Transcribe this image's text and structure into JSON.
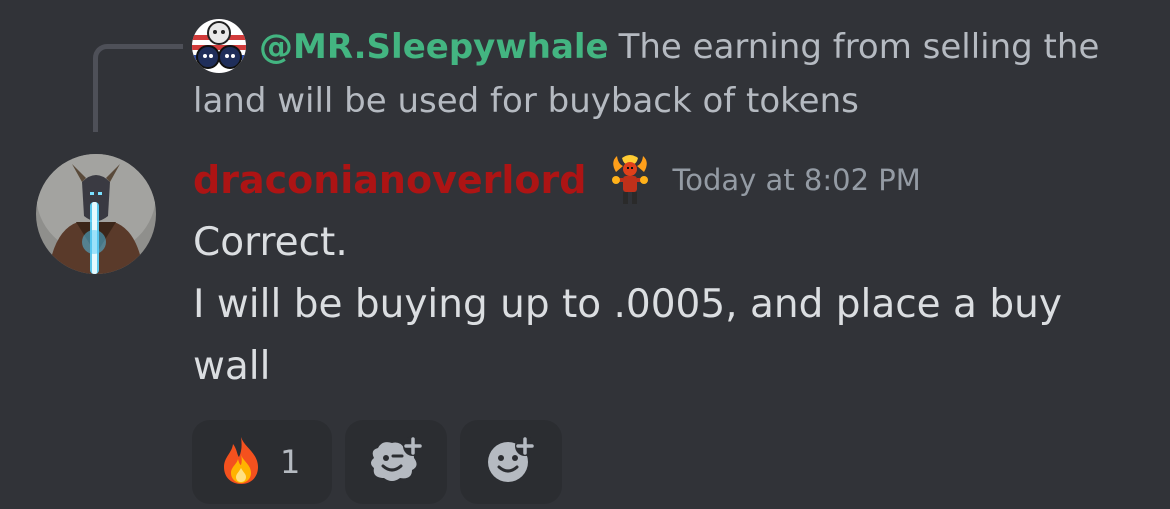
{
  "reply": {
    "author": "@MR.Sleepywhale",
    "text": "The earning from selling the land will be used for buyback of tokens"
  },
  "message": {
    "author": "draconianoverlord",
    "timestamp": "Today at 8:02 PM",
    "lines": [
      "Correct.",
      "I will be buying up to .0005, and place a buy wall"
    ]
  },
  "reactions": [
    {
      "emoji": "fire-icon",
      "count": "1"
    },
    {
      "emoji": "add-super-reaction-icon"
    },
    {
      "emoji": "add-reaction-icon"
    }
  ],
  "colors": {
    "background": "#313338",
    "reply_author": "#43b581",
    "author": "#ad1414",
    "text": "#dbdee1",
    "muted": "#b5bac1",
    "timestamp": "#949ba4",
    "reaction_bg": "#2b2d31"
  }
}
